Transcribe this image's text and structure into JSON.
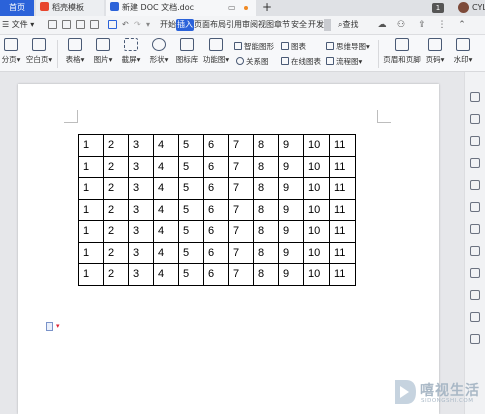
{
  "tabs": {
    "home": "首页",
    "templates": "稻壳模板",
    "document": "新建 DOC 文档.doc",
    "new_tab": "+",
    "badge": "1",
    "user": "CYL"
  },
  "menu": {
    "file": "文件",
    "ribbon_tabs": [
      "开始",
      "插入",
      "页面布局",
      "引用",
      "审阅",
      "视图",
      "章节",
      "安全",
      "开发"
    ],
    "active_tab": "插入",
    "search": "查找"
  },
  "ribbon": {
    "page_break": "分页",
    "blank_page": "空白页",
    "table": "表格",
    "picture": "图片",
    "screenshot": "截屏",
    "shapes": "形状",
    "icon_lib": "图标库",
    "function_chart": "功能图",
    "smart_graphic": "智能图形",
    "chart": "图表",
    "relation_graph": "关系图",
    "online_chart": "在线图表",
    "mind_map": "思维导图",
    "flowchart": "流程图",
    "header_footer": "页眉和页脚",
    "page_number": "页码",
    "watermark": "水印"
  },
  "document": {
    "table_rows": [
      [
        "1",
        "2",
        "3",
        "4",
        "5",
        "6",
        "7",
        "8",
        "9",
        "10",
        "11"
      ],
      [
        "1",
        "2",
        "3",
        "4",
        "5",
        "6",
        "7",
        "8",
        "9",
        "10",
        "11"
      ],
      [
        "1",
        "2",
        "3",
        "4",
        "5",
        "6",
        "7",
        "8",
        "9",
        "10",
        "11"
      ],
      [
        "1",
        "2",
        "3",
        "4",
        "5",
        "6",
        "7",
        "8",
        "9",
        "10",
        "11"
      ],
      [
        "1",
        "2",
        "3",
        "4",
        "5",
        "6",
        "7",
        "8",
        "9",
        "10",
        "11"
      ],
      [
        "1",
        "2",
        "3",
        "4",
        "5",
        "6",
        "7",
        "8",
        "9",
        "10",
        "11"
      ],
      [
        "1",
        "2",
        "3",
        "4",
        "5",
        "6",
        "7",
        "8",
        "9",
        "10",
        "11"
      ]
    ]
  },
  "site_watermark": {
    "name": "嘻视生活",
    "domain": "SIDONGSHI.COM"
  },
  "colors": {
    "accent": "#2b62d9",
    "tab_bar": "#dfe1e5",
    "workspace": "#e6e7ea"
  }
}
